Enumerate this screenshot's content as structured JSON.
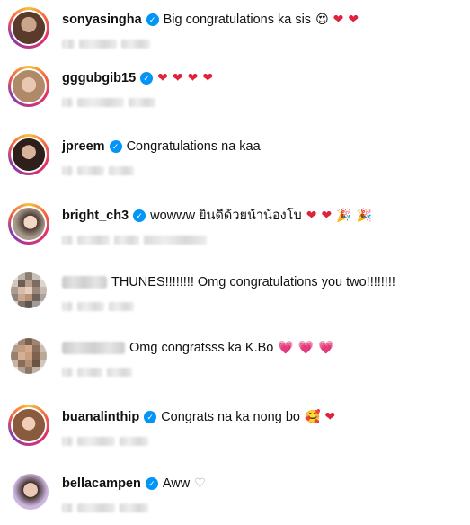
{
  "comments": [
    {
      "username": "sonyasingha",
      "verified": true,
      "text": "Big congratulations ka sis",
      "emojis": [
        "😍",
        "❤",
        "❤"
      ]
    },
    {
      "username": "gggubgib15",
      "verified": true,
      "text": "",
      "emojis": [
        "❤",
        "❤",
        "❤",
        "❤"
      ]
    },
    {
      "username": "jpreem",
      "verified": true,
      "text": "Congratulations na kaa",
      "emojis": []
    },
    {
      "username": "bright_ch3",
      "verified": true,
      "text": "wowww ยินดีด้วยน้าน้องโบ",
      "emojis": [
        "❤",
        "❤",
        "🎉",
        "🎉"
      ]
    },
    {
      "username": "",
      "verified": false,
      "text": "THUNES!!!!!!!! Omg congratulations you two!!!!!!!!",
      "emojis": []
    },
    {
      "username": "",
      "verified": false,
      "text": "Omg congratsss ka K.Bo",
      "emojis": [
        "💗",
        "💗",
        "💗"
      ]
    },
    {
      "username": "buanalinthip",
      "verified": true,
      "text": "Congrats na ka nong bo",
      "emojis": [
        "🥰",
        "❤"
      ]
    },
    {
      "username": "bellacampen",
      "verified": true,
      "text": "Aww",
      "emojis": [
        "♡"
      ]
    }
  ],
  "icons": {
    "verified": "verified-badge-icon",
    "heart": "heart-icon"
  },
  "colors": {
    "verified_badge": "#0095f6",
    "heart": "#e0213a",
    "pink_heart": "#f25fa8",
    "ring_start": "#f9c23c",
    "ring_end": "#833ab4"
  }
}
